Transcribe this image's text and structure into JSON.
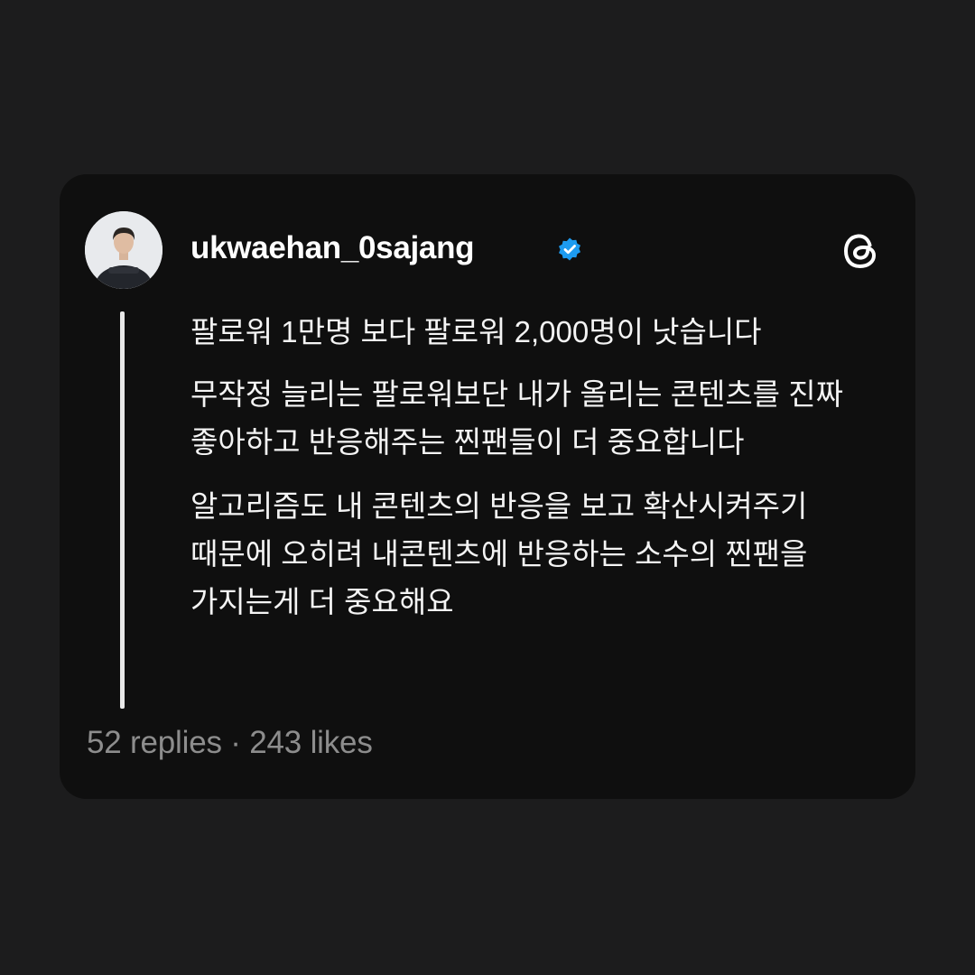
{
  "post": {
    "username": "ukwaehan_0sajang",
    "verified_icon": "verified-badge-icon",
    "brand_icon": "threads-logo-icon",
    "paragraphs": [
      "팔로워 1만명 보다 팔로워 2,000명이 낫습니다",
      "무작정 늘리는 팔로워보단 내가 올리는 콘텐츠를 진짜 좋아하고 반응해주는 찐팬들이 더 중요합니다",
      "알고리즘도 내 콘텐츠의 반응을 보고 확산시켜주기 때문에 오히려 내콘텐츠에 반응하는 소수의 찐팬을 가지는게 더 중요해요"
    ],
    "replies": "52 replies",
    "separator": " · ",
    "likes": "243 likes"
  },
  "colors": {
    "page_background": "#1c1c1d",
    "card_background": "#0f0f0f",
    "text": "#f4f4f4",
    "muted_text": "#8d8d8d",
    "verified_blue": "#1d9bf0"
  }
}
